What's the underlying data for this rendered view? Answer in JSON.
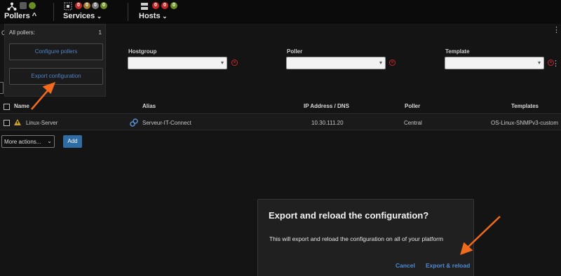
{
  "topbar": {
    "pollers": {
      "label": "Pollers",
      "chevron": "^"
    },
    "services": {
      "label": "Services",
      "chevron": "v",
      "badges": [
        "0",
        "0",
        "0",
        "0"
      ]
    },
    "hosts": {
      "label": "Hosts",
      "chevron": "v",
      "badges": [
        "0",
        "0",
        "0"
      ]
    }
  },
  "colors": {
    "critical": "#c62828",
    "warning": "#a0782a",
    "ok": "#6b8e23",
    "pending": "#7a7a7a",
    "accent": "#4f83c7"
  },
  "filters": {
    "page_letter": "C",
    "hostgroup_label": "Hostgroup",
    "poller_label": "Poller",
    "template_label": "Template"
  },
  "table": {
    "headers": {
      "name": "Name",
      "alias": "Alias",
      "ip": "IP Address / DNS",
      "poller": "Poller",
      "templates": "Templates"
    },
    "rows": [
      {
        "name": "Linux-Server",
        "alias": "Serveur-IT-Connect",
        "ip": "10.30.111.20",
        "poller": "Central",
        "templates": "OS-Linux-SNMPv3-custom"
      }
    ]
  },
  "actions": {
    "more_actions": "More actions...",
    "add": "Add"
  },
  "dropdown": {
    "header": "All pollers:",
    "count": "1",
    "configure": "Configure pollers",
    "export": "Export configuration"
  },
  "modal": {
    "title": "Export and reload the configuration?",
    "text": "This will export and reload the configuration on all of your platform",
    "cancel": "Cancel",
    "confirm": "Export & reload"
  }
}
